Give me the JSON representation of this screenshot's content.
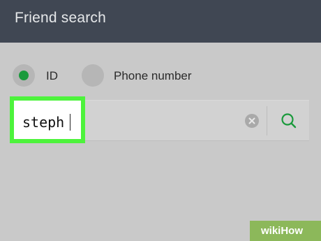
{
  "header": {
    "title": "Friend search"
  },
  "search_type": {
    "options": [
      {
        "label": "ID",
        "selected": true
      },
      {
        "label": "Phone number",
        "selected": false
      }
    ]
  },
  "search": {
    "value": "steph",
    "clear_icon": "clear-icon",
    "search_icon": "search-icon"
  },
  "watermark": {
    "text": "wikiHow"
  },
  "colors": {
    "header_bg": "#404753",
    "body_bg": "#c9c9c9",
    "accent_green": "#1a9a3c",
    "highlight": "#4df33c"
  }
}
